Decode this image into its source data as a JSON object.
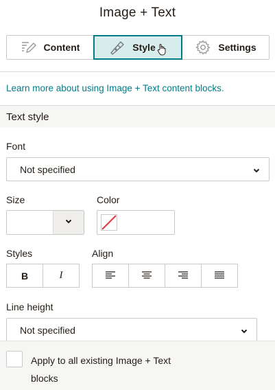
{
  "header": {
    "title": "Image + Text"
  },
  "tabs": [
    {
      "label": "Content",
      "icon": "pencil-lines-icon",
      "active": false
    },
    {
      "label": "Style",
      "icon": "paint-brush-icon",
      "active": true
    },
    {
      "label": "Settings",
      "icon": "gear-icon",
      "active": false
    }
  ],
  "learn_more": "Learn more about using Image + Text content blocks.",
  "section": {
    "title": "Text style"
  },
  "font": {
    "label": "Font",
    "value": "Not specified"
  },
  "size": {
    "label": "Size",
    "value": ""
  },
  "color": {
    "label": "Color",
    "value": "none"
  },
  "styles": {
    "label": "Styles",
    "bold": "B",
    "italic": "I"
  },
  "align": {
    "label": "Align",
    "options": [
      "left",
      "center",
      "right",
      "justify"
    ]
  },
  "line_height": {
    "label": "Line height",
    "value": "Not specified"
  },
  "footer": {
    "apply_label": "Apply to all existing Image + Text blocks",
    "checked": false
  },
  "colors": {
    "accent": "#007c89",
    "active_tab_bg": "#d7ecec",
    "no_color_slash": "#e0383e"
  }
}
